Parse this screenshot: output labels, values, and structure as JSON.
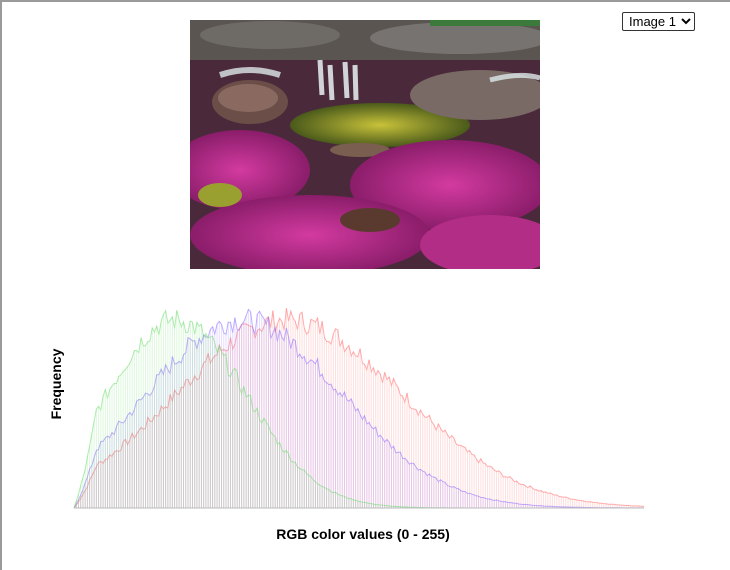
{
  "selector": {
    "selected": "Image 1",
    "options": [
      "Image 1"
    ]
  },
  "photo": {
    "subject": "river with magenta aquatic plants, rocks and small waterfalls"
  },
  "histogram": {
    "ylabel": "Frequency",
    "xlabel": "RGB color values (0 - 255)"
  },
  "chart_data": {
    "type": "area",
    "title": "",
    "xlabel": "RGB color values (0 - 255)",
    "ylabel": "Frequency",
    "xlim": [
      0,
      255
    ],
    "grid": false,
    "legend": "none",
    "series": [
      {
        "color": "#ff6b6b",
        "peak_x": 95,
        "spread": 52,
        "level": 1.0
      },
      {
        "color": "#8b6bff",
        "peak_x": 75,
        "spread": 45,
        "level": 1.0
      },
      {
        "color": "#6bdc6b",
        "peak_x": 45,
        "spread": 32,
        "level": 1.0
      }
    ]
  }
}
